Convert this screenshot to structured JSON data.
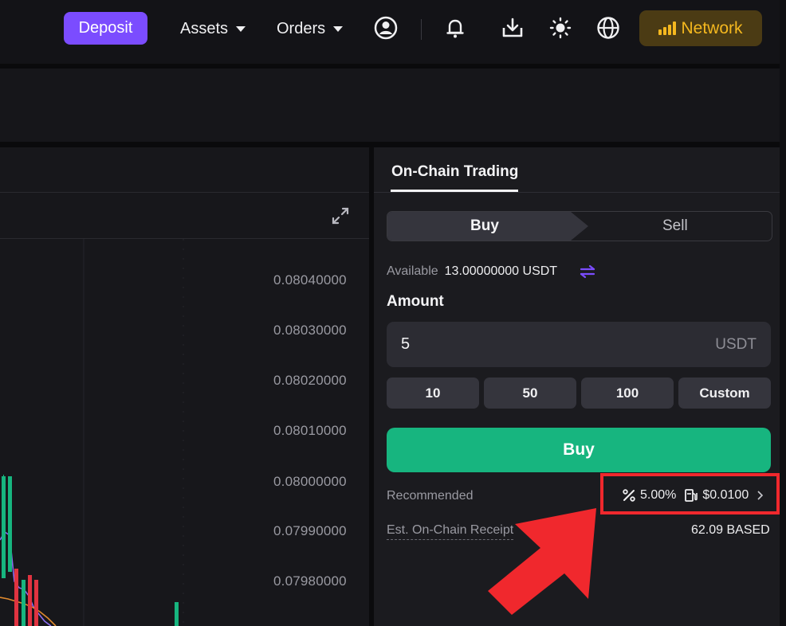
{
  "header": {
    "deposit_label": "Deposit",
    "assets_label": "Assets",
    "orders_label": "Orders",
    "network_label": "Network"
  },
  "chart": {
    "price_labels": [
      "0.08040000",
      "0.08030000",
      "0.08020000",
      "0.08010000",
      "0.08000000",
      "0.07990000",
      "0.07980000"
    ]
  },
  "trading": {
    "tab_label": "On-Chain Trading",
    "buy_tab": "Buy",
    "sell_tab": "Sell",
    "available_label": "Available",
    "available_value": "13.00000000 USDT",
    "amount_label": "Amount",
    "amount_value": "5",
    "amount_unit": "USDT",
    "presets": [
      "10",
      "50",
      "100",
      "Custom"
    ],
    "buy_button": "Buy",
    "recommended_label": "Recommended",
    "slippage": "5.00%",
    "gas_fee": "$0.0100",
    "receipt_label": "Est. On-Chain Receipt",
    "receipt_value": "62.09 BASED"
  },
  "colors": {
    "accent_purple": "#7b4cff",
    "buy_green": "#17b57f",
    "network_gold": "#f5b81f",
    "highlight_red": "#f0282d"
  }
}
